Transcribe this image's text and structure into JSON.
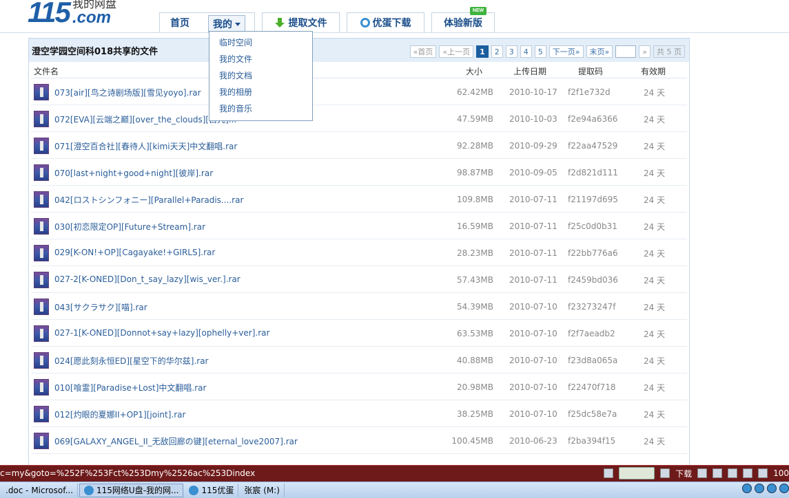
{
  "header": {
    "logo_num": "115",
    "logo_cn": "我的网盘",
    "logo_com": ".com",
    "nav": {
      "home": "首页",
      "mine": "我的",
      "extract": "提取文件",
      "youdan": "优蛋下载",
      "newver": "体验新版",
      "new_badge": "NEW"
    }
  },
  "dropdown": {
    "items": [
      "临时空间",
      "我的文件",
      "我的文档",
      "我的相册",
      "我的音乐"
    ]
  },
  "panel": {
    "title": "澄空学园空间科018共享的文件",
    "pager": {
      "first": "«首页",
      "prev": "«上一页",
      "pages": [
        "1",
        "2",
        "3",
        "4",
        "5"
      ],
      "next": "下一页»",
      "last": "末页»",
      "go": "»",
      "total": "共 5 页"
    },
    "columns": {
      "name": "文件名",
      "size": "大小",
      "date": "上传日期",
      "code": "提取码",
      "valid": "有效期"
    },
    "files": [
      {
        "name": "073[air][鸟之诗剧场版][雪见yoyo].rar",
        "size": "62.42MB",
        "date": "2010-10-17",
        "code": "f2f1e732d",
        "valid": "24 天"
      },
      {
        "name": "072[EVA][云端之巅][over_the_clouds][白咒]...",
        "size": "47.59MB",
        "date": "2010-10-03",
        "code": "f2e94a6366",
        "valid": "24 天"
      },
      {
        "name": "071[澄空百合社][春待人][kimi天天]中文翻唱.rar",
        "size": "92.28MB",
        "date": "2010-09-29",
        "code": "f22aa47529",
        "valid": "24 天"
      },
      {
        "name": "070[last+night+good+night][彼岸].rar",
        "size": "98.87MB",
        "date": "2010-09-05",
        "code": "f2d821d111",
        "valid": "24 天"
      },
      {
        "name": "042[ロストシンフォニー][Parallel+Paradis....rar",
        "size": "109.8MB",
        "date": "2010-07-11",
        "code": "f21197d695",
        "valid": "24 天"
      },
      {
        "name": "030[初恋限定OP][Future+Stream].rar",
        "size": "16.59MB",
        "date": "2010-07-11",
        "code": "f25c0d0b31",
        "valid": "24 天"
      },
      {
        "name": "029[K-ON!+OP][Cagayake!+GIRLS].rar",
        "size": "28.23MB",
        "date": "2010-07-11",
        "code": "f22bb776a6",
        "valid": "24 天"
      },
      {
        "name": "027-2[K-ONED][Don_t_say_lazy][wis_ver.].rar",
        "size": "57.43MB",
        "date": "2010-07-11",
        "code": "f2459bd036",
        "valid": "24 天"
      },
      {
        "name": "043[サクラサク][喵].rar",
        "size": "54.39MB",
        "date": "2010-07-10",
        "code": "f23273247f",
        "valid": "24 天"
      },
      {
        "name": "027-1[K-ONED][Donnot+say+lazy][ophelly+ver].rar",
        "size": "63.53MB",
        "date": "2010-07-10",
        "code": "f2f7aeadb2",
        "valid": "24 天"
      },
      {
        "name": "024[愿此刻永恒ED][星空下的华尔兹].rar",
        "size": "40.88MB",
        "date": "2010-07-10",
        "code": "f23d8a065a",
        "valid": "24 天"
      },
      {
        "name": "010[喰霊][Paradise+Lost]中文翻唱.rar",
        "size": "20.98MB",
        "date": "2010-07-10",
        "code": "f22470f718",
        "valid": "24 天"
      },
      {
        "name": "012[灼眼的夏娜II+OP1][joint].rar",
        "size": "38.25MB",
        "date": "2010-07-10",
        "code": "f25dc58e7a",
        "valid": "24 天"
      },
      {
        "name": "069[GALAXY_ANGEL_II_无敌回廊の键][eternal_love2007].rar",
        "size": "100.45MB",
        "date": "2010-06-23",
        "code": "f2ba394f15",
        "valid": "24 天"
      }
    ]
  },
  "statusbar": {
    "url": "c=my&goto=%252F%253Fct%253Dmy%2526ac%253Dindex",
    "download": "下载",
    "zoom": "100"
  },
  "taskbar": {
    "items": [
      ".doc - Microsof...",
      "115网络U盘-我的网...",
      "115优蛋",
      "张宸 (M:)"
    ]
  },
  "colors": {
    "brand": "#1f5fa8",
    "link": "#2a5d9a",
    "current_page": "#1a5e9e",
    "statusbar": "#6e1a1a"
  }
}
